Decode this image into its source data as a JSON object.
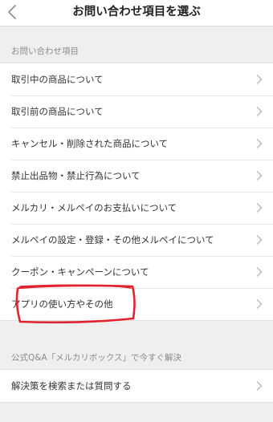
{
  "header": {
    "title": "お問い合わせ項目を選ぶ",
    "back_icon": "chevron-left-icon"
  },
  "inquiry_section": {
    "title": "お問い合わせ項目",
    "items": [
      {
        "label": "取引中の商品について"
      },
      {
        "label": "取引前の商品について"
      },
      {
        "label": "キャンセル・削除された商品について"
      },
      {
        "label": "禁止出品物・禁止行為について"
      },
      {
        "label": "メルカリ・メルペイのお支払いについて"
      },
      {
        "label": "メルペイの設定・登録・その他メルペイについて"
      },
      {
        "label": "クーポン・キャンペーンについて"
      },
      {
        "label": "アプリの使い方やその他"
      }
    ]
  },
  "faq_section": {
    "title": "公式Q&A「メルカリボックス」で今すぐ解決",
    "items": [
      {
        "label": "解決策を検索または質問する"
      }
    ]
  },
  "colors": {
    "annotation": "#e0232e",
    "chevron": "#b8b8b8",
    "background": "#efeff0"
  }
}
